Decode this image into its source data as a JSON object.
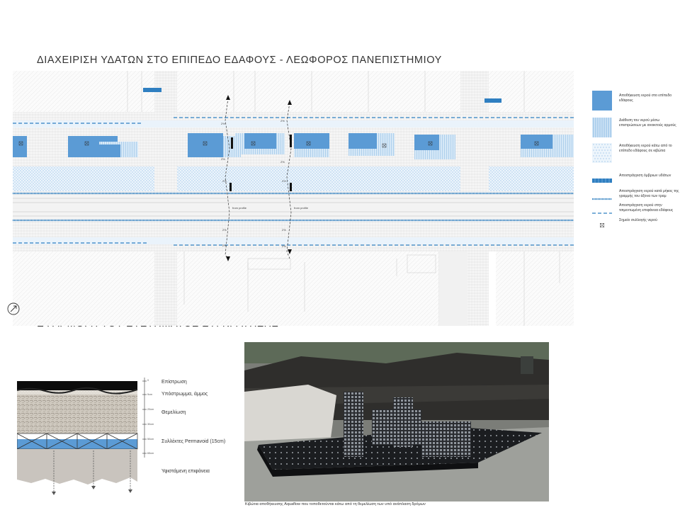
{
  "titles": {
    "plan": "ΔΙΑΧΕΙΡΙΣΗ ΥΔΑΤΩΝ ΣΤΟ ΕΠΙΠΕΔΟ ΕΔΑΦΟΥΣ -  ΛΕΩΦΟΡΟΣ ΠΑΝΕΠΙΣΤΗΜΙΟΥ",
    "application": "ΕΦΑΡΜΟΓΗ ΤΟΥ ΣΥΣΤΗΜΑΤΟΣ ΣΥΓΚΡΑΤΗΣΗΣ"
  },
  "colors": {
    "storage_blue": "#5b9bd5",
    "diffusion_blue": "#a9cdee",
    "underground_blue": "#d4e6f6",
    "channel_blue": "#2f7fc1",
    "line_dark": "#2a6fb0"
  },
  "legend": [
    {
      "text": "Αποθήκευση νερού στο επίπεδο εδάφους",
      "symbol": "solid-fill"
    },
    {
      "text": "Διάθεση του νερού μέσω επιστρώσεων με ανοικτούς αρμούς",
      "symbol": "striped-fill"
    },
    {
      "text": "Αποθήκευση νερού κάτω από το επίπεδο εδάφους σε κιβώτια",
      "symbol": "dotted-fill"
    },
    {
      "text": "Αποστράγγιση όμβριων υδάτων",
      "symbol": "channel"
    },
    {
      "text": "Αποστράγγιση νερού κατά μήκος της γραμμής του άξονα των τραμ",
      "symbol": "dotted-line"
    },
    {
      "text": "Αποστράγγιση νερού στην τσιμεντωμένη επιφάνεια εδάφους",
      "symbol": "dashed-line"
    },
    {
      "text": "Σημείο συλλογής νερού",
      "symbol": "collection-point"
    }
  ],
  "plan_labels": {
    "slope": "2%",
    "profile": "from profile"
  },
  "section": {
    "layers": [
      {
        "label": "Επίστρωση",
        "depth": "0"
      },
      {
        "label": "Υπόστρωμμα, άμμος",
        "depth": "9cm"
      },
      {
        "label": "Θεμελίωση",
        "depth": "20cm"
      },
      {
        "label": "Συλλέκτες Permavoid (15cm)",
        "depth": "50cm"
      },
      {
        "label": "Υφιστάμενη επιφάνεια",
        "depth": "65cm"
      }
    ],
    "extra_depth": "30cm"
  },
  "photo_caption": "Κιβώτια αποθήκευσης Aquaflow που τοποθετούνται κάτω από τη θεμελίωση των υπό ανάπλαση δρόμων"
}
